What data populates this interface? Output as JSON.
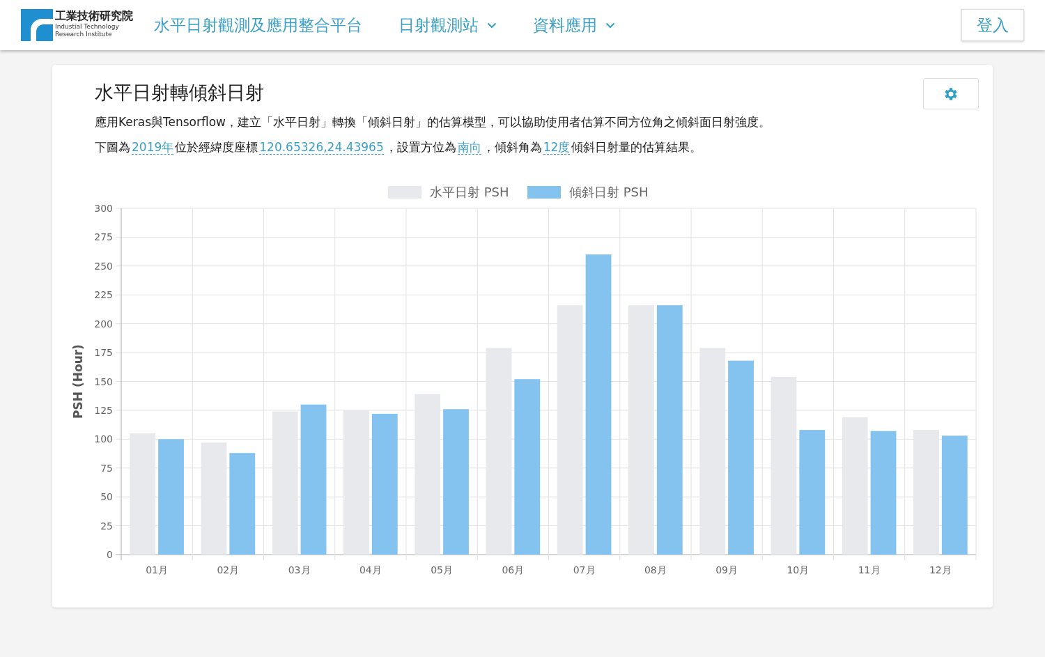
{
  "header": {
    "logo": {
      "name_zh": "工業技術研究院",
      "name_en_1": "Industial Technology",
      "name_en_2": "Research Institute"
    },
    "site_title": "水平日射觀測及應用整合平台",
    "nav": [
      {
        "label": "日射觀測站",
        "kind": "dropdown"
      },
      {
        "label": "資料應用",
        "kind": "dropdown"
      }
    ],
    "login": "登入"
  },
  "card": {
    "title": "水平日射轉傾斜日射",
    "description": "應用Keras與Tensorflow，建立「水平日射」轉換「傾斜日射」的估算模型，可以協助使用者估算不同方位角之傾斜面日射強度。",
    "summary": [
      {
        "kind": "text",
        "text": "下圖為"
      },
      {
        "kind": "link",
        "text": "2019年"
      },
      {
        "kind": "text",
        "text": "位於經緯度座標"
      },
      {
        "kind": "link",
        "text": "120.65326,24.43965"
      },
      {
        "kind": "text",
        "text": "，設置方位為"
      },
      {
        "kind": "link",
        "text": "南向"
      },
      {
        "kind": "text",
        "text": "，傾斜角為"
      },
      {
        "kind": "link",
        "text": "12度"
      },
      {
        "kind": "text",
        "text": "傾斜日射量的估算結果。"
      }
    ],
    "chart_data": {
      "type": "bar",
      "ylabel": "PSH (Hour)",
      "categories": [
        "01月",
        "02月",
        "03月",
        "04月",
        "05月",
        "06月",
        "07月",
        "08月",
        "09月",
        "10月",
        "11月",
        "12月"
      ],
      "series": [
        {
          "name": "水平日射 PSH",
          "color": "#e7e9ed",
          "values": [
            105,
            97,
            124,
            125,
            139,
            179,
            216,
            216,
            179,
            154,
            119,
            108
          ]
        },
        {
          "name": "傾斜日射 PSH",
          "color": "#84c3ef",
          "values": [
            100,
            88,
            130,
            122,
            126,
            152,
            260,
            216,
            168,
            108,
            107,
            103
          ]
        }
      ],
      "grid": true,
      "legend": true,
      "ylim": [
        0,
        300
      ],
      "yticks": [
        0,
        25,
        50,
        75,
        100,
        125,
        150,
        175,
        200,
        225,
        250,
        275,
        300
      ]
    }
  }
}
